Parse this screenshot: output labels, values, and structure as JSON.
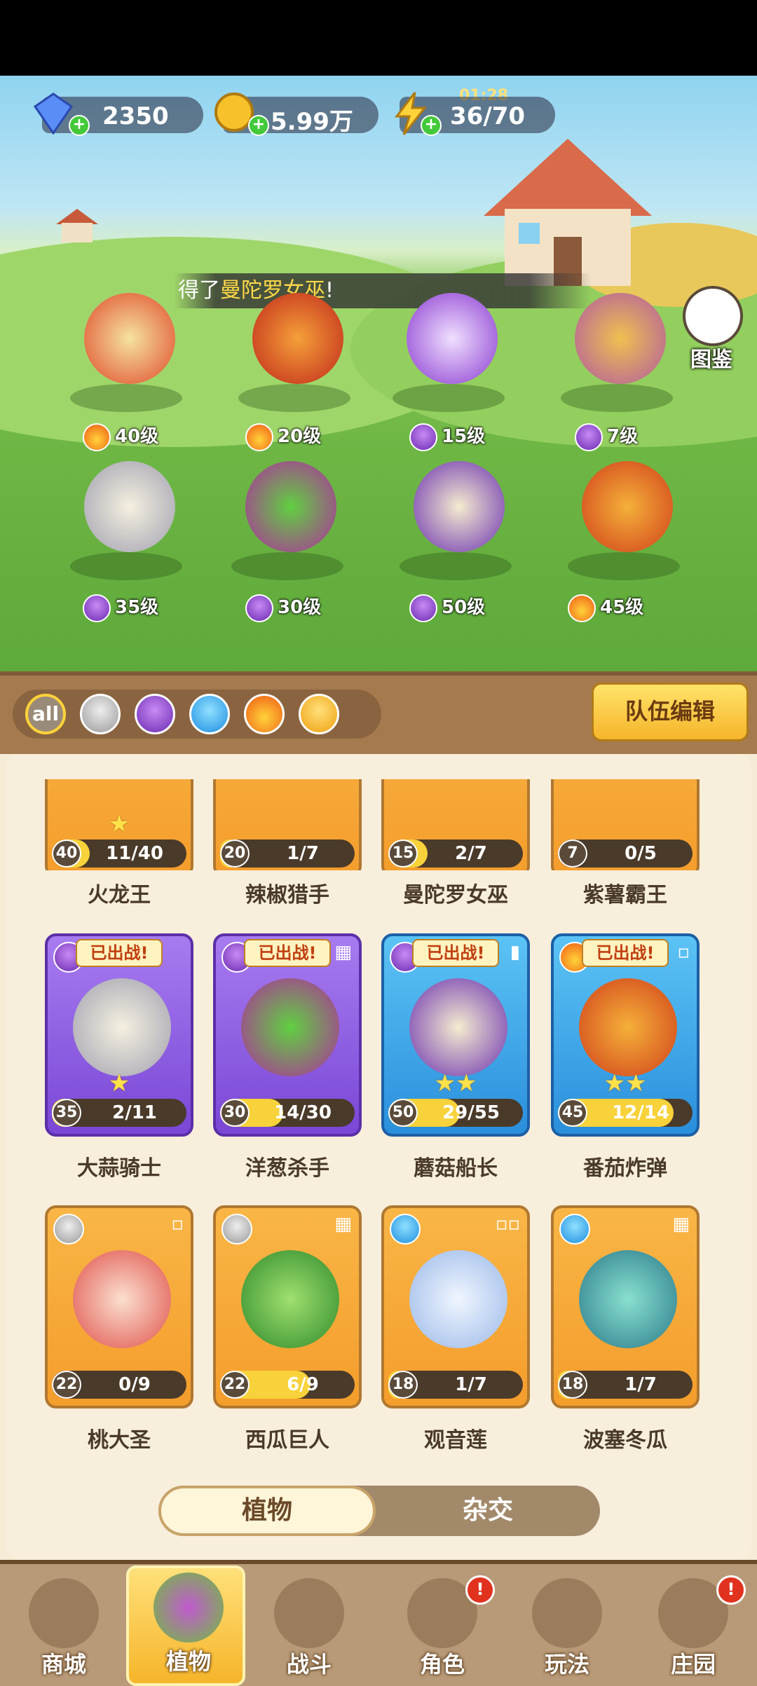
{
  "resources": {
    "gems": "2350",
    "coins": "5.99万",
    "energy": "36/70",
    "timer": "01:28"
  },
  "notice": {
    "prefix": "得了",
    "name": "曼陀罗女巫",
    "suffix": "!"
  },
  "codex_label": "图鉴",
  "team_plants": [
    {
      "level": "40级",
      "element": "fire-icon"
    },
    {
      "level": "20级",
      "element": "fire-icon"
    },
    {
      "level": "15级",
      "element": "dark-icon"
    },
    {
      "level": "7级",
      "element": "dark-icon"
    },
    {
      "level": "35级",
      "element": "dark-icon"
    },
    {
      "level": "30级",
      "element": "dark-icon"
    },
    {
      "level": "50级",
      "element": "dark-icon"
    },
    {
      "level": "45级",
      "element": "fire-icon"
    }
  ],
  "filters": {
    "all": "all",
    "team_edit": "队伍编辑"
  },
  "cards_row1": [
    {
      "name": "火龙王",
      "level": "40",
      "progress": "11/40",
      "fill": 0.28
    },
    {
      "name": "辣椒猎手",
      "level": "20",
      "progress": "1/7",
      "fill": 0.14
    },
    {
      "name": "曼陀罗女巫",
      "level": "15",
      "progress": "2/7",
      "fill": 0.29
    },
    {
      "name": "紫薯霸王",
      "level": "7",
      "progress": "0/5",
      "fill": 0.0
    }
  ],
  "cards_row2": [
    {
      "name": "大蒜骑士",
      "level": "35",
      "progress": "2/11",
      "fill": 0.18,
      "badge": "已出战!"
    },
    {
      "name": "洋葱杀手",
      "level": "30",
      "progress": "14/30",
      "fill": 0.47,
      "badge": "已出战!"
    },
    {
      "name": "蘑菇船长",
      "level": "50",
      "progress": "29/55",
      "fill": 0.53,
      "badge": "已出战!"
    },
    {
      "name": "番茄炸弹",
      "level": "45",
      "progress": "12/14",
      "fill": 0.86,
      "badge": "已出战!"
    }
  ],
  "cards_row3": [
    {
      "name": "桃大圣",
      "level": "22",
      "progress": "0/9",
      "fill": 0.0
    },
    {
      "name": "西瓜巨人",
      "level": "22",
      "progress": "6/9",
      "fill": 0.67
    },
    {
      "name": "观音莲",
      "level": "18",
      "progress": "1/7",
      "fill": 0.14
    },
    {
      "name": "波塞冬瓜",
      "level": "18",
      "progress": "1/7",
      "fill": 0.14
    }
  ],
  "segment": {
    "plants": "植物",
    "hybrid": "杂交"
  },
  "nav": [
    "商城",
    "植物",
    "战斗",
    "角色",
    "玩法",
    "庄园"
  ],
  "colors": {
    "gold_card": "#f49d2c",
    "purple_card": "#7a47d6",
    "blue_card": "#2a8fdc",
    "accent": "#ffd23a"
  }
}
